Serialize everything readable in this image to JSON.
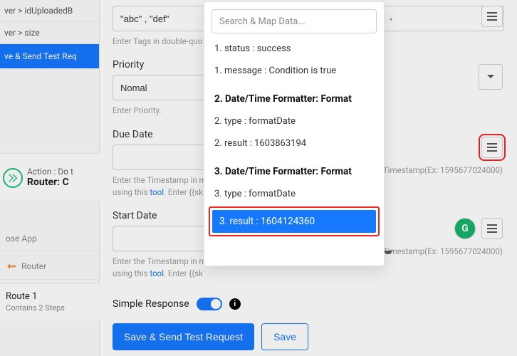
{
  "colors": {
    "accent": "#1677ff",
    "highlight_border": "#f02424",
    "success": "#17b36a"
  },
  "left": {
    "crumb1": "ver > idUploadedB",
    "crumb2": "ver > size",
    "blue_button": "ve & Send Test Req",
    "action_label": "Action : Do t",
    "action_title": "Router: C",
    "choose_app": "ose App",
    "router_text": "Router",
    "route_title": "Route 1",
    "route_sub": "Contains 2 Steps"
  },
  "form": {
    "tags_value": "\"abc\" , \"def\"",
    "tags_hint": "Enter Tags in double-quo",
    "priority_label": "Priority",
    "priority_value": "Nomal",
    "priority_hint": "Enter Priority.",
    "due_label": "Due Date",
    "due_hint_prefix": "Enter the Timestamp in m",
    "due_hint_tool": "tool",
    "due_hint_using": "using this",
    "due_hint_enter": ". Enter {{sk",
    "due_hint_ts": "Timestamp(Ex: 1595677024000)",
    "start_label": "Start Date",
    "start_hint_prefix": "Enter the Timestamp in m",
    "start_hint_using": "using this",
    "start_hint_tool": "tool",
    "start_hint_enter": ". Enter {{sk",
    "start_hint_ts": "Timestamp(Ex: 1595677024000)",
    "simple_resp_label": "Simple Response",
    "save_send": "Save & Send Test Request",
    "save": "Save"
  },
  "overlay": {
    "search_placeholder": "Search & Map Data...",
    "items_group1": [
      "1. status : success",
      "1. message : Condition is true"
    ],
    "heading2": "2. Date/Time Formatter: Format",
    "items_group2": [
      "2. type : formatDate",
      "2. result : 1603863194"
    ],
    "heading3": "3. Date/Time Formatter: Format",
    "items_group3": [
      "3. type : formatDate"
    ],
    "selected": "3. result : 1604124360"
  },
  "icons": {
    "hamburger": "hamburger-icon",
    "router": "router-icon",
    "info": "i",
    "green_badge": "G"
  }
}
